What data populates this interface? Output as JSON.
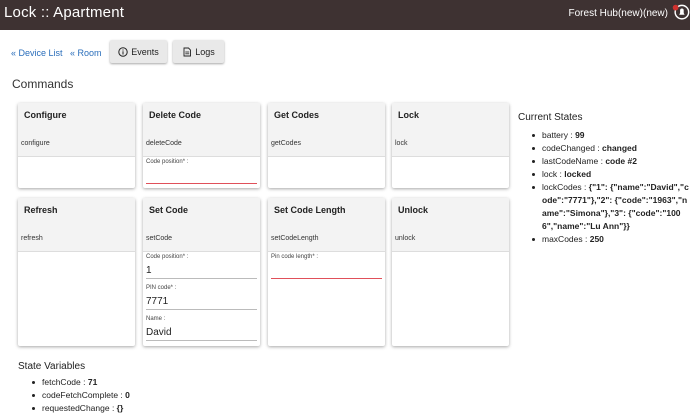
{
  "header": {
    "title": "Lock :: Apartment",
    "hub_name": "Forest Hub(new)(new)",
    "bell_icon": "notification-bell-icon",
    "bg_color": "#3e3232"
  },
  "nav": {
    "device_list": "« Device List",
    "room": "« Room",
    "events": "Events",
    "logs": "Logs",
    "events_icon": "info-circle-icon",
    "logs_icon": "document-icon"
  },
  "commands_title": "Commands",
  "commands": [
    {
      "name": "Configure",
      "command": "configure"
    },
    {
      "name": "Delete Code",
      "command": "deleteCode",
      "fields": [
        {
          "label": "Code position* :",
          "value": ""
        }
      ]
    },
    {
      "name": "Get Codes",
      "command": "getCodes"
    },
    {
      "name": "Lock",
      "command": "lock"
    },
    {
      "name": "Refresh",
      "command": "refresh"
    },
    {
      "name": "Set Code",
      "command": "setCode",
      "fields": [
        {
          "label": "Code position* :",
          "value": "1"
        },
        {
          "label": "PIN code* :",
          "value": "7771"
        },
        {
          "label": "Name :",
          "value": "David"
        }
      ]
    },
    {
      "name": "Set Code Length",
      "command": "setCodeLength",
      "fields": [
        {
          "label": "Pin code length* :",
          "value": ""
        }
      ]
    },
    {
      "name": "Unlock",
      "command": "unlock"
    }
  ],
  "current_states": {
    "title": "Current States",
    "items": [
      {
        "key": "battery : ",
        "value": "99"
      },
      {
        "key": "codeChanged : ",
        "value": "changed"
      },
      {
        "key": "lastCodeName : ",
        "value": "code #2"
      },
      {
        "key": "lock : ",
        "value": "locked"
      },
      {
        "key": "lockCodes : ",
        "value": "{\"1\": {\"name\":\"David\",\"code\":\"7771\"},\"2\": {\"code\":\"1963\",\"name\":\"Simona\"},\"3\": {\"code\":\"1006\",\"name\":\"Lu Ann\"}}"
      },
      {
        "key": "maxCodes : ",
        "value": "250"
      }
    ]
  },
  "state_variables": {
    "title": "State Variables",
    "items": [
      {
        "key": "fetchCode : ",
        "value": "71"
      },
      {
        "key": "codeFetchComplete : ",
        "value": "0"
      },
      {
        "key": "requestedChange : ",
        "value": "{}"
      }
    ]
  }
}
